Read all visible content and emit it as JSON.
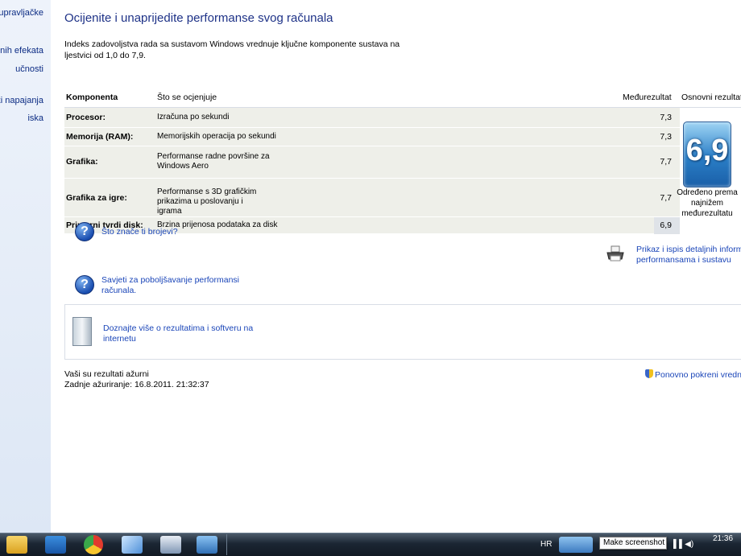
{
  "sidebar": {
    "links": [
      "upravljačke",
      "lnih efekata",
      "učnosti",
      "vki napajanja",
      "iska"
    ]
  },
  "main": {
    "title": "Ocijenite i unaprijedite performanse svog računala",
    "description": "Indeks zadovoljstva rada sa sustavom Windows vrednuje ključne komponente sustava na ljestvici od 1,0 do 7,9."
  },
  "table": {
    "headers": {
      "component": "Komponenta",
      "rates": "Što se ocjenjuje",
      "subscore": "Međurezultat",
      "base": "Osnovni rezultat"
    },
    "rows": [
      {
        "component": "Procesor:",
        "rates": "Izračuna po sekundi",
        "subscore": "7,3"
      },
      {
        "component": "Memorija (RAM):",
        "rates": "Memorijskih operacija po sekundi",
        "subscore": "7,3"
      },
      {
        "component": "Grafika:",
        "rates": "Performanse radne površine za Windows Aero",
        "subscore": "7,7"
      },
      {
        "component": "Grafika za igre:",
        "rates": "Performanse s 3D grafičkim prikazima u poslovanju i igrama",
        "subscore": "7,7"
      },
      {
        "component": "Primarni tvrdi disk:",
        "rates": "Brzina prijenosa podataka za disk",
        "subscore": "6,9"
      }
    ],
    "base_score": "6,9",
    "base_note": "Određeno prema najnižem međurezultatu"
  },
  "links": {
    "what_mean": "Što znače ti brojevi?",
    "tips_line1": "Savjeti za poboljšavanje performansi",
    "tips_line2": "računala.",
    "print_line1": "Prikaz i ispis detaljnih informacija",
    "print_line2": "performansama i sustavu",
    "learn_line1": "Doznajte više o rezultatima i softveru na",
    "learn_line2": "internetu"
  },
  "status": {
    "line1": "Vaši su rezultati ažurni",
    "line2": "Zadnje ažuriranje: 16.8.2011. 21:32:37",
    "rerun": "Ponovno pokreni vrednova"
  },
  "taskbar": {
    "language": "HR",
    "tooltip": "Make screenshot",
    "clock": "21:36"
  }
}
